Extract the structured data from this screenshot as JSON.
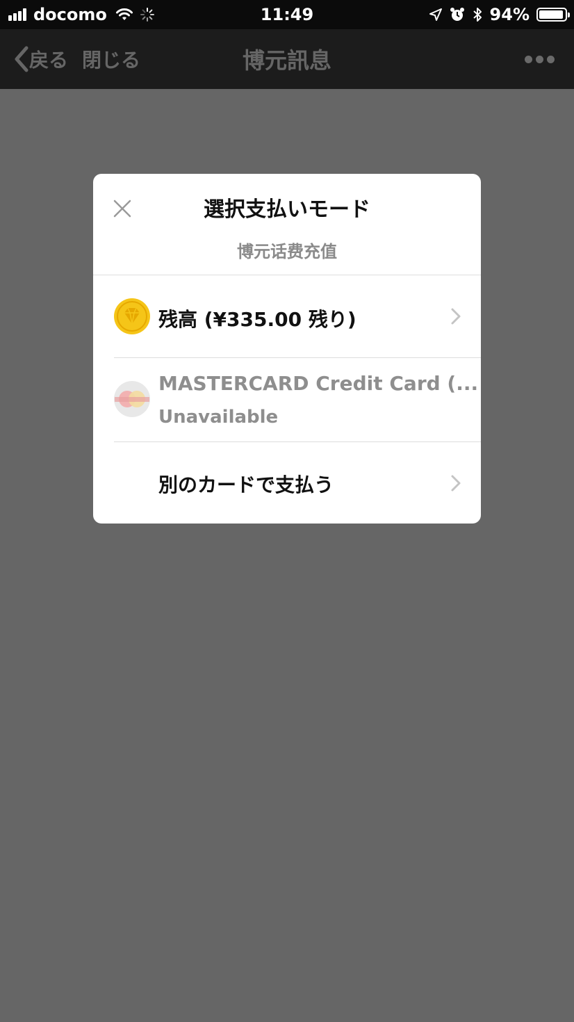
{
  "status_bar": {
    "carrier": "docomo",
    "time": "11:49",
    "battery_percent": "94%",
    "battery_level": 0.94,
    "icons": [
      "signal-icon",
      "wifi-icon",
      "activity-spinner-icon",
      "location-arrow-icon",
      "alarm-icon",
      "bluetooth-icon",
      "battery-icon"
    ]
  },
  "nav": {
    "back_label": "戻る",
    "close_label": "閉じる",
    "title": "博元訊息",
    "more_icon": "more-dots-icon"
  },
  "modal": {
    "title": "選択支払いモード",
    "subtitle": "博元话费充值",
    "close_icon": "close-icon",
    "options": [
      {
        "label": "残高 (¥335.00 残り)",
        "icon": "balance-coin-icon",
        "icon_color": "#f5c518",
        "enabled": true
      },
      {
        "label": "MASTERCARD Credit Card (...",
        "sub": "Unavailable",
        "icon": "mastercard-icon",
        "enabled": false
      },
      {
        "label": "別のカードで支払う",
        "enabled": true
      }
    ]
  },
  "colors": {
    "overlay": "#666666",
    "status_bar": "#0b0b0b",
    "nav_bar": "#1c1c1c",
    "modal_bg": "#ffffff",
    "coin_yellow": "#f5c518"
  }
}
